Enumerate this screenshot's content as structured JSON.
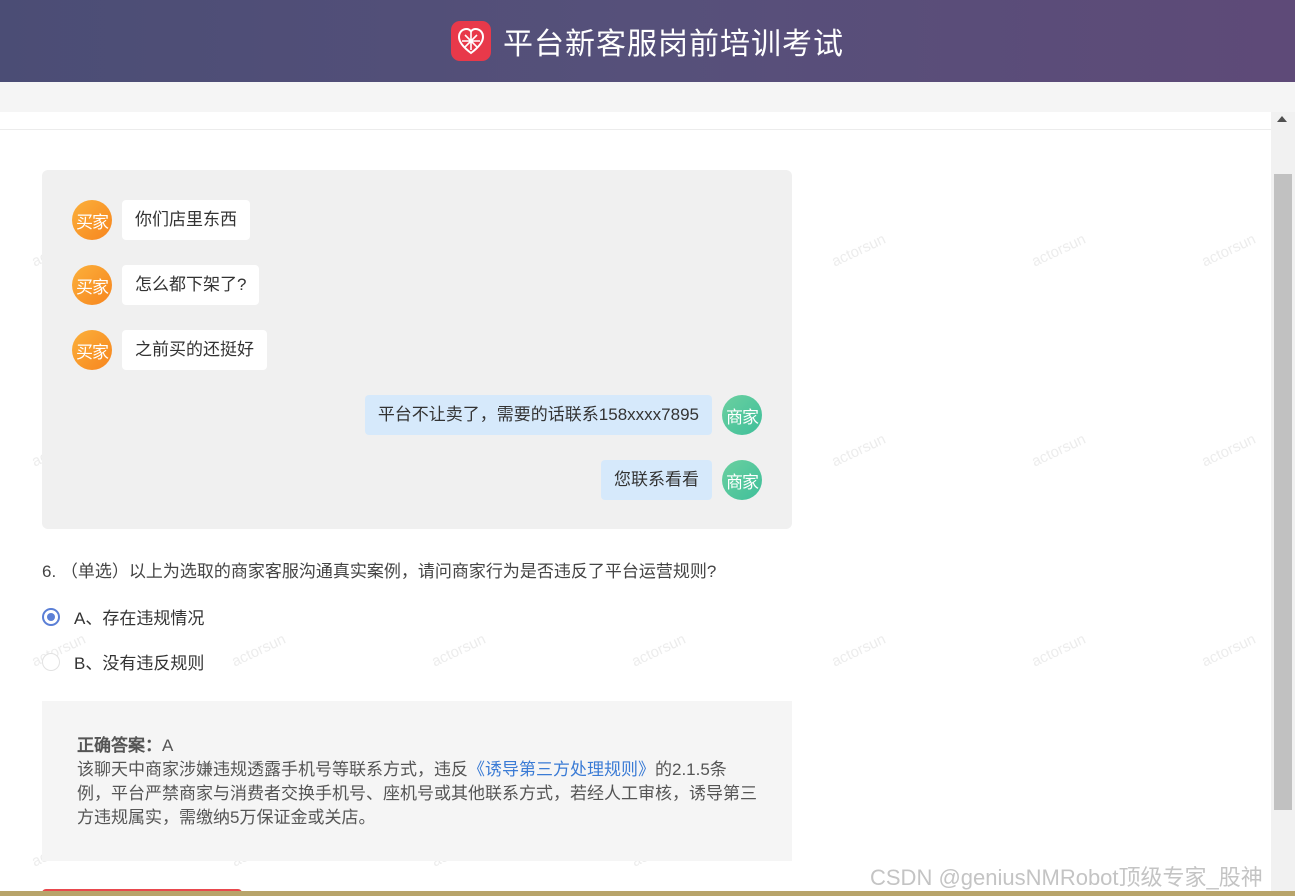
{
  "header": {
    "title": "平台新客服岗前培训考试",
    "logo_icon": "temu-pinduoduo-logo-icon"
  },
  "colors": {
    "header_start": "#4b4d75",
    "header_end": "#5e4a78",
    "buyer_avatar": "#f7851e",
    "seller_avatar": "#3fbf9a",
    "seller_bubble": "#d6e9fb",
    "radio_checked": "#5b7fd6",
    "link": "#3a7bd5"
  },
  "chat": {
    "buyer_label": "买家",
    "seller_label": "商家",
    "messages": [
      {
        "role": "buyer",
        "text": "你们店里东西"
      },
      {
        "role": "buyer",
        "text": "怎么都下架了?"
      },
      {
        "role": "buyer",
        "text": "之前买的还挺好"
      },
      {
        "role": "seller",
        "text": "平台不让卖了，需要的话联系158xxxx7895"
      },
      {
        "role": "seller",
        "text": "您联系看看"
      }
    ]
  },
  "question": {
    "text": "6. （单选）以上为选取的商家客服沟通真实案例，请问商家行为是否违反了平台运营规则?",
    "options": [
      {
        "label": "A、存在违规情况",
        "selected": true
      },
      {
        "label": "B、没有违反规则",
        "selected": false
      }
    ]
  },
  "answer": {
    "label": "正确答案：",
    "value": "A",
    "explanation_before": "该聊天中商家涉嫌违规透露手机号等联系方式，违反",
    "rule_link": "《诱导第三方处理规则》",
    "explanation_after": "的2.1.5条例，平台严禁商家与消费者交换手机号、座机号或其他联系方式，若经人工审核，诱导第三方违规属实，需缴纳5万保证金或关店。"
  },
  "watermark": {
    "text": "actorsun"
  },
  "footer_watermark": "CSDN @geniusNMRobot顶级专家_股神"
}
